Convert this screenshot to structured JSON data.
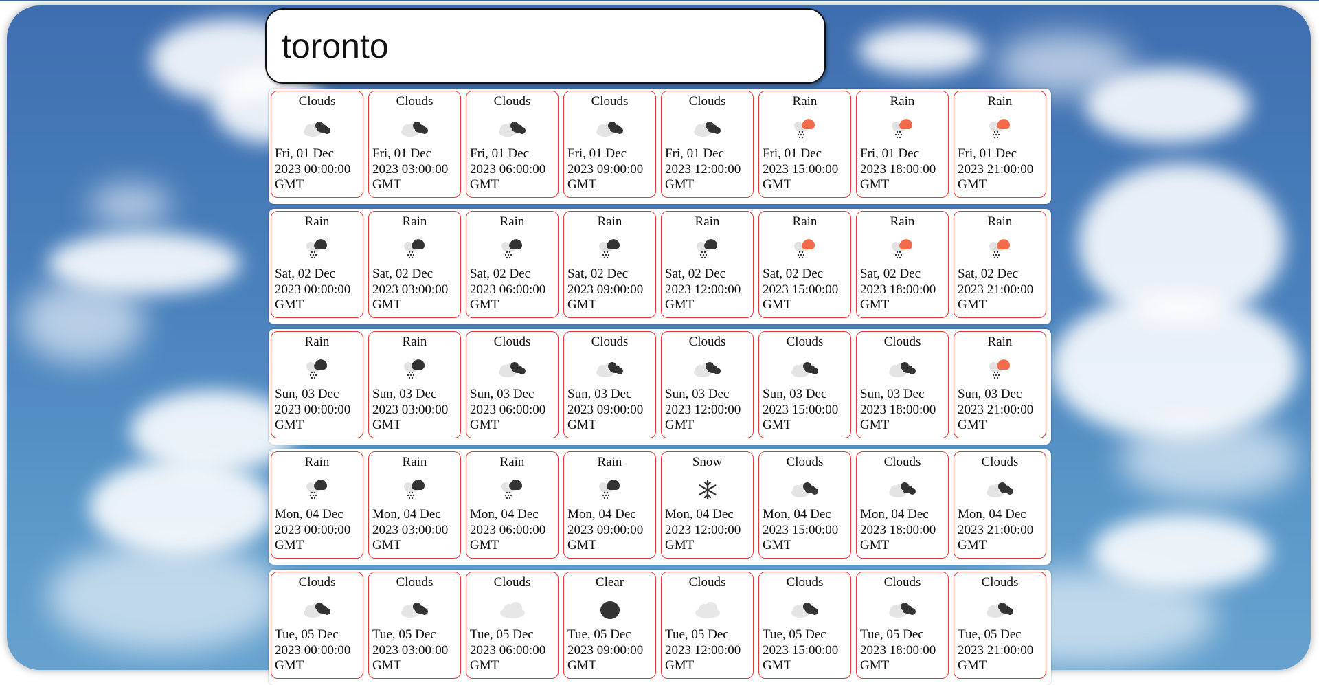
{
  "search": {
    "value": "toronto"
  },
  "colors": {
    "card_border": "#e53935",
    "sky": "#4b82bd",
    "sun": "#f26b4a",
    "icon": "#333333"
  },
  "rows": [
    {
      "cards": [
        {
          "condition": "Clouds",
          "icon": "broken-clouds-icon",
          "date": "Fri, 01 Dec 2023 00:00:00 GMT"
        },
        {
          "condition": "Clouds",
          "icon": "broken-clouds-icon",
          "date": "Fri, 01 Dec 2023 03:00:00 GMT"
        },
        {
          "condition": "Clouds",
          "icon": "broken-clouds-icon",
          "date": "Fri, 01 Dec 2023 06:00:00 GMT"
        },
        {
          "condition": "Clouds",
          "icon": "broken-clouds-icon",
          "date": "Fri, 01 Dec 2023 09:00:00 GMT"
        },
        {
          "condition": "Clouds",
          "icon": "broken-clouds-icon",
          "date": "Fri, 01 Dec 2023 12:00:00 GMT"
        },
        {
          "condition": "Rain",
          "icon": "sun-rain-icon",
          "date": "Fri, 01 Dec 2023 15:00:00 GMT"
        },
        {
          "condition": "Rain",
          "icon": "sun-rain-icon",
          "date": "Fri, 01 Dec 2023 18:00:00 GMT"
        },
        {
          "condition": "Rain",
          "icon": "sun-rain-icon",
          "date": "Fri, 01 Dec 2023 21:00:00 GMT"
        }
      ]
    },
    {
      "cards": [
        {
          "condition": "Rain",
          "icon": "cloud-rain-icon",
          "date": "Sat, 02 Dec 2023 00:00:00 GMT"
        },
        {
          "condition": "Rain",
          "icon": "cloud-rain-icon",
          "date": "Sat, 02 Dec 2023 03:00:00 GMT"
        },
        {
          "condition": "Rain",
          "icon": "cloud-rain-icon",
          "date": "Sat, 02 Dec 2023 06:00:00 GMT"
        },
        {
          "condition": "Rain",
          "icon": "cloud-rain-icon",
          "date": "Sat, 02 Dec 2023 09:00:00 GMT"
        },
        {
          "condition": "Rain",
          "icon": "cloud-rain-icon",
          "date": "Sat, 02 Dec 2023 12:00:00 GMT"
        },
        {
          "condition": "Rain",
          "icon": "sun-rain-icon",
          "date": "Sat, 02 Dec 2023 15:00:00 GMT"
        },
        {
          "condition": "Rain",
          "icon": "sun-rain-icon",
          "date": "Sat, 02 Dec 2023 18:00:00 GMT"
        },
        {
          "condition": "Rain",
          "icon": "sun-rain-icon",
          "date": "Sat, 02 Dec 2023 21:00:00 GMT"
        }
      ]
    },
    {
      "cards": [
        {
          "condition": "Rain",
          "icon": "cloud-rain-icon",
          "date": "Sun, 03 Dec 2023 00:00:00 GMT"
        },
        {
          "condition": "Rain",
          "icon": "cloud-rain-icon",
          "date": "Sun, 03 Dec 2023 03:00:00 GMT"
        },
        {
          "condition": "Clouds",
          "icon": "broken-clouds-icon",
          "date": "Sun, 03 Dec 2023 06:00:00 GMT"
        },
        {
          "condition": "Clouds",
          "icon": "broken-clouds-icon",
          "date": "Sun, 03 Dec 2023 09:00:00 GMT"
        },
        {
          "condition": "Clouds",
          "icon": "broken-clouds-icon",
          "date": "Sun, 03 Dec 2023 12:00:00 GMT"
        },
        {
          "condition": "Clouds",
          "icon": "broken-clouds-icon",
          "date": "Sun, 03 Dec 2023 15:00:00 GMT"
        },
        {
          "condition": "Clouds",
          "icon": "broken-clouds-icon",
          "date": "Sun, 03 Dec 2023 18:00:00 GMT"
        },
        {
          "condition": "Rain",
          "icon": "sun-rain-icon",
          "date": "Sun, 03 Dec 2023 21:00:00 GMT"
        }
      ]
    },
    {
      "cards": [
        {
          "condition": "Rain",
          "icon": "cloud-rain-icon",
          "date": "Mon, 04 Dec 2023 00:00:00 GMT"
        },
        {
          "condition": "Rain",
          "icon": "cloud-rain-icon",
          "date": "Mon, 04 Dec 2023 03:00:00 GMT"
        },
        {
          "condition": "Rain",
          "icon": "cloud-rain-icon",
          "date": "Mon, 04 Dec 2023 06:00:00 GMT"
        },
        {
          "condition": "Rain",
          "icon": "cloud-rain-icon",
          "date": "Mon, 04 Dec 2023 09:00:00 GMT"
        },
        {
          "condition": "Snow",
          "icon": "snowflake-icon",
          "date": "Mon, 04 Dec 2023 12:00:00 GMT"
        },
        {
          "condition": "Clouds",
          "icon": "broken-clouds-icon",
          "date": "Mon, 04 Dec 2023 15:00:00 GMT"
        },
        {
          "condition": "Clouds",
          "icon": "broken-clouds-icon",
          "date": "Mon, 04 Dec 2023 18:00:00 GMT"
        },
        {
          "condition": "Clouds",
          "icon": "broken-clouds-icon",
          "date": "Mon, 04 Dec 2023 21:00:00 GMT"
        }
      ]
    },
    {
      "cards": [
        {
          "condition": "Clouds",
          "icon": "broken-clouds-icon",
          "date": "Tue, 05 Dec 2023 00:00:00 GMT"
        },
        {
          "condition": "Clouds",
          "icon": "broken-clouds-icon",
          "date": "Tue, 05 Dec 2023 03:00:00 GMT"
        },
        {
          "condition": "Clouds",
          "icon": "light-cloud-icon",
          "date": "Tue, 05 Dec 2023 06:00:00 GMT"
        },
        {
          "condition": "Clear",
          "icon": "clear-moon-icon",
          "date": "Tue, 05 Dec 2023 09:00:00 GMT"
        },
        {
          "condition": "Clouds",
          "icon": "light-cloud-icon",
          "date": "Tue, 05 Dec 2023 12:00:00 GMT"
        },
        {
          "condition": "Clouds",
          "icon": "broken-clouds-icon",
          "date": "Tue, 05 Dec 2023 15:00:00 GMT"
        },
        {
          "condition": "Clouds",
          "icon": "broken-clouds-icon",
          "date": "Tue, 05 Dec 2023 18:00:00 GMT"
        },
        {
          "condition": "Clouds",
          "icon": "broken-clouds-icon",
          "date": "Tue, 05 Dec 2023 21:00:00 GMT"
        }
      ]
    }
  ]
}
